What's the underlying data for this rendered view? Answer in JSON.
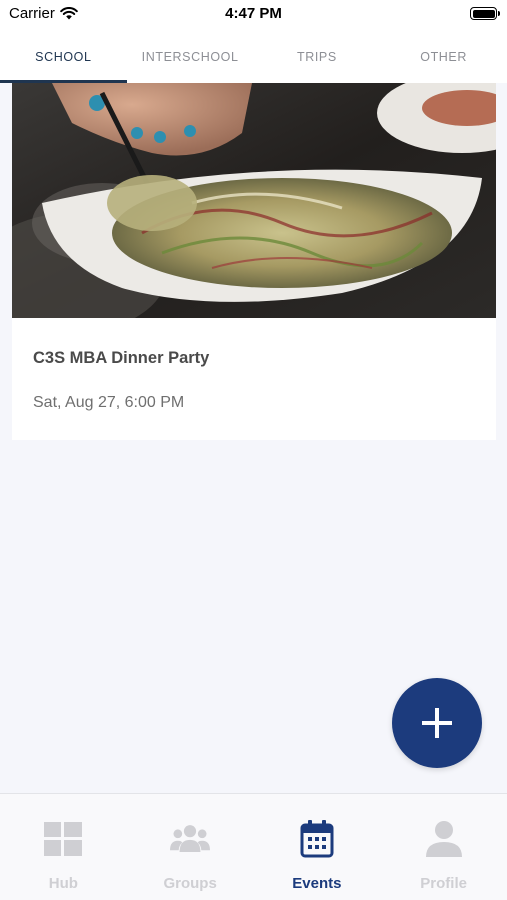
{
  "status_bar": {
    "carrier": "Carrier",
    "time": "4:47 PM"
  },
  "tabs": [
    {
      "label": "SCHOOL",
      "active": true
    },
    {
      "label": "INTERSCHOOL",
      "active": false
    },
    {
      "label": "TRIPS",
      "active": false
    },
    {
      "label": "OTHER",
      "active": false
    }
  ],
  "events": [
    {
      "title": "C3S MBA Dinner Party",
      "datetime": "Sat, Aug 27, 6:00 PM",
      "image": "salad-dinner-photo"
    }
  ],
  "fab": {
    "icon": "plus-icon"
  },
  "bottom_nav": [
    {
      "label": "Hub",
      "icon": "grid-icon",
      "active": false
    },
    {
      "label": "Groups",
      "icon": "people-icon",
      "active": false
    },
    {
      "label": "Events",
      "icon": "calendar-icon",
      "active": true
    },
    {
      "label": "Profile",
      "icon": "person-icon",
      "active": false
    }
  ],
  "colors": {
    "accent": "#1c3b7d",
    "tab_active": "#1f3550",
    "inactive": "#cfcfd3",
    "background": "#f5f6fb"
  }
}
